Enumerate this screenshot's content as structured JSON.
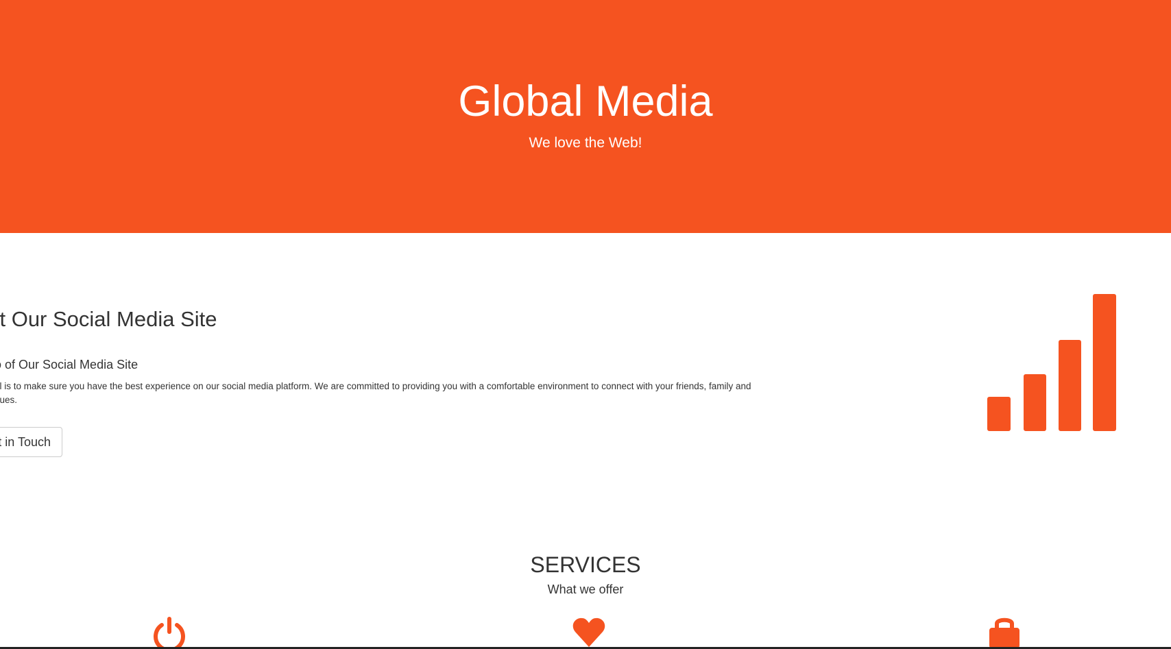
{
  "hero": {
    "title": "Global Media",
    "subtitle": "We love the Web!",
    "background_color": "#f55320"
  },
  "about": {
    "heading": "out Our Social Media Site",
    "subheading": "o of Our Social Media Site",
    "text_line_1": "al is to make sure you have the best experience on our social media platform. We are committed to providing you with a comfortable environment to connect with your friends, family and",
    "text_line_2": "ques.",
    "button_label": "t in Touch",
    "icon": "signal-bars-icon",
    "accent_color": "#f55320"
  },
  "services": {
    "title": "SERVICES",
    "subtitle": "What we offer",
    "icons": [
      "power-icon",
      "heart-icon",
      "lock-icon"
    ]
  }
}
